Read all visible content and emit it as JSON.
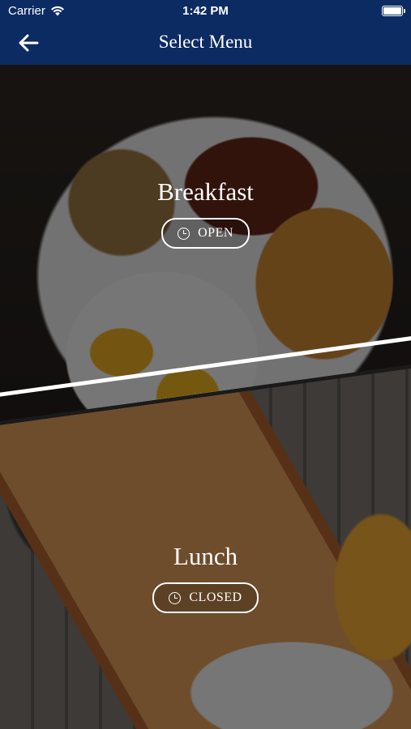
{
  "status_bar": {
    "carrier": "Carrier",
    "time": "1:42 PM",
    "battery_level": 1.0
  },
  "nav": {
    "title": "Select Menu",
    "back_icon": "arrow-left-icon"
  },
  "menus": [
    {
      "name": "Breakfast",
      "status": "OPEN",
      "status_icon": "clock-icon"
    },
    {
      "name": "Lunch",
      "status": "CLOSED",
      "status_icon": "clock-icon"
    }
  ],
  "colors": {
    "nav_background": "#0c2b63",
    "text": "#ffffff"
  }
}
